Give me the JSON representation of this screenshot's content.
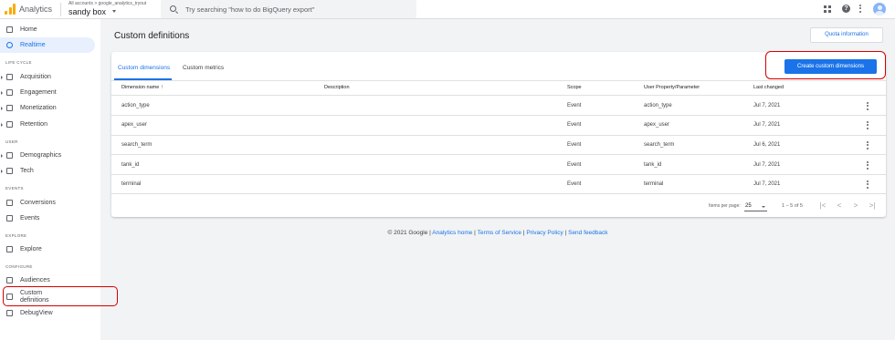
{
  "header": {
    "app_name": "Analytics",
    "account_breadcrumb": "All accounts > google_analytics_tryout",
    "property_name": "sandy box",
    "search_placeholder": "Try searching \"how to do BigQuery export\""
  },
  "sidebar": {
    "items": [
      {
        "label": "Home"
      },
      {
        "label": "Realtime"
      },
      {
        "label": "Acquisition"
      },
      {
        "label": "Engagement"
      },
      {
        "label": "Monetization"
      },
      {
        "label": "Retention"
      },
      {
        "label": "Demographics"
      },
      {
        "label": "Tech"
      },
      {
        "label": "Conversions"
      },
      {
        "label": "Events"
      },
      {
        "label": "Explore"
      },
      {
        "label": "Audiences"
      },
      {
        "label_line1": "Custom",
        "label_line2": "definitions"
      },
      {
        "label": "DebugView"
      }
    ],
    "sections": {
      "life_cycle": "LIFE CYCLE",
      "user": "USER",
      "events": "EVENTS",
      "explore": "EXPLORE",
      "configure": "CONFIGURE"
    }
  },
  "main": {
    "title": "Custom definitions",
    "quota_button": "Quota information",
    "tabs": [
      {
        "label": "Custom dimensions"
      },
      {
        "label": "Custom metrics"
      }
    ],
    "create_button": "Create custom dimensions",
    "table": {
      "headers": [
        "Dimension name",
        "Description",
        "Scope",
        "User Property/Parameter",
        "Last changed"
      ],
      "sort_arrow": "↑",
      "rows": [
        {
          "name": "action_type",
          "description": "",
          "scope": "Event",
          "param": "action_type",
          "changed": "Jul 7, 2021"
        },
        {
          "name": "apex_user",
          "description": "",
          "scope": "Event",
          "param": "apex_user",
          "changed": "Jul 7, 2021"
        },
        {
          "name": "search_term",
          "description": "",
          "scope": "Event",
          "param": "search_term",
          "changed": "Jul 6, 2021"
        },
        {
          "name": "tank_id",
          "description": "",
          "scope": "Event",
          "param": "tank_id",
          "changed": "Jul 7, 2021"
        },
        {
          "name": "terminal",
          "description": "",
          "scope": "Event",
          "param": "terminal",
          "changed": "Jul 7, 2021"
        }
      ]
    },
    "pagination": {
      "items_per_page_label": "Items per page:",
      "items_per_page_value": "25",
      "range": "1 – 5 of 5",
      "first": "|<",
      "prev": "<",
      "next": ">",
      "last": ">|"
    }
  },
  "footer": {
    "copyright": "© 2021 Google |",
    "analytics_home": "Analytics home",
    "sep1": "|",
    "terms": "Terms of Service",
    "sep2": "|",
    "privacy": "Privacy Policy",
    "sep3": "|",
    "feedback": "Send feedback"
  },
  "colors": {
    "accent": "#1a73e8",
    "highlight": "#d50000",
    "logo": "#f9ab00"
  }
}
